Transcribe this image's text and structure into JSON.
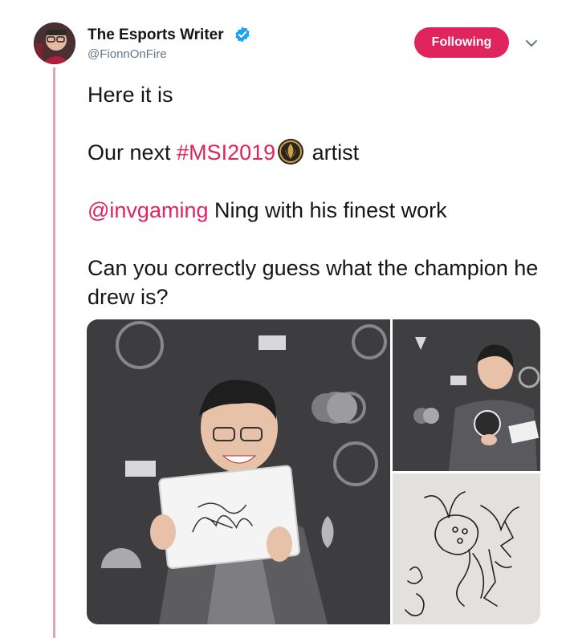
{
  "tweet": {
    "author": {
      "name": "The Esports Writer",
      "handle": "@FionnOnFire",
      "verified": true,
      "avatar_icon": "profile-photo"
    },
    "follow_button": {
      "label": "Following",
      "color": "#e0245e"
    },
    "menu_icon": "chevron-down-icon",
    "text": {
      "line1": "Here it is",
      "line2_prefix": "Our next ",
      "hashtag": "#MSI2019",
      "hashtag_emoji_icon": "msi-logo-icon",
      "line2_suffix": " artist",
      "mention": "@invgaming",
      "line3_suffix": " Ning with his finest work",
      "line4": "Can you correctly guess what the champion he drew is?"
    },
    "media": [
      {
        "description_icon": "photo-player-holding-drawing"
      },
      {
        "description_icon": "photo-player-drawing"
      },
      {
        "description_icon": "photo-drawing-closeup"
      }
    ]
  },
  "colors": {
    "accent": "#e0245e",
    "thread_line": "#e1a6bd",
    "handle": "#657786",
    "verified": "#1da1f2"
  }
}
